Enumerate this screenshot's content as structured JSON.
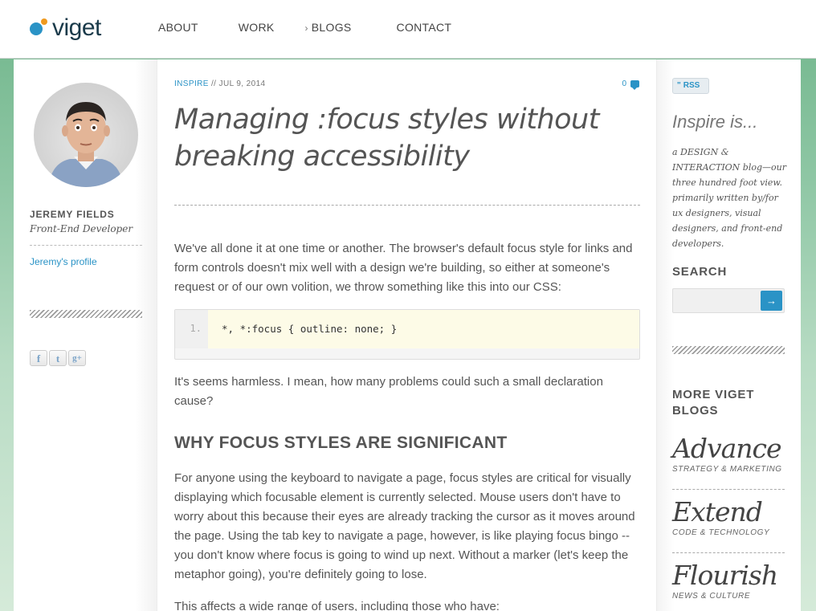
{
  "header": {
    "logo_text": "viget",
    "nav": [
      {
        "label": "ABOUT"
      },
      {
        "label": "WORK"
      },
      {
        "label": "BLOGS"
      },
      {
        "label": "CONTACT"
      }
    ]
  },
  "author": {
    "name": "JEREMY FIELDS",
    "title": "Front-End Developer",
    "profile_link": "Jeremy's profile"
  },
  "social": [
    {
      "label": "f",
      "icon": "facebook-icon"
    },
    {
      "label": "t",
      "icon": "twitter-icon"
    },
    {
      "label": "g+",
      "icon": "google-plus-icon"
    }
  ],
  "post": {
    "category": "INSPIRE",
    "separator": "//",
    "date": "JUL 9, 2014",
    "comment_count": "0",
    "title": "Managing :focus styles without breaking accessibility",
    "intro": "We've all done it at one time or another. The browser's default focus style for links and form controls doesn't mix well with a design we're building, so either at someone's request or of our own volition, we throw something like this into our CSS:",
    "code_line_number": "1.",
    "code_line": "*, *:focus { outline: none; }",
    "after_code": "It's seems harmless. I mean, how many problems could such a small declaration cause?",
    "heading": "WHY FOCUS STYLES ARE SIGNIFICANT",
    "body": "For anyone using the keyboard to navigate a page, focus styles are critical for visually displaying which focusable element is currently selected. Mouse users don't have to worry about this because their eyes are already tracking the cursor as it moves around the page. Using the tab key to navigate a page, however, is like playing focus bingo -- you don't know where focus is going to wind up next. Without a marker (let's keep the metaphor going), you're definitely going to lose.",
    "trailing": "This affects a wide range of users, including those who have:"
  },
  "sidebar": {
    "rss_label": "RSS",
    "inspire_title": "Inspire is...",
    "inspire_desc": "a DESIGN & INTERACTION blog—our three hundred foot view. primarily written by/for ux designers, visual designers, and front-end developers.",
    "search_label": "SEARCH",
    "search_placeholder": "",
    "more_label": "MORE VIGET BLOGS",
    "blogs": [
      {
        "name": "Advance",
        "tag": "STRATEGY & MARKETING"
      },
      {
        "name": "Extend",
        "tag": "CODE & TECHNOLOGY"
      },
      {
        "name": "Flourish",
        "tag": "NEWS & CULTURE"
      }
    ]
  },
  "colors": {
    "accent": "#2a93c6",
    "logo_orange": "#f09a1f",
    "text": "#555555"
  }
}
